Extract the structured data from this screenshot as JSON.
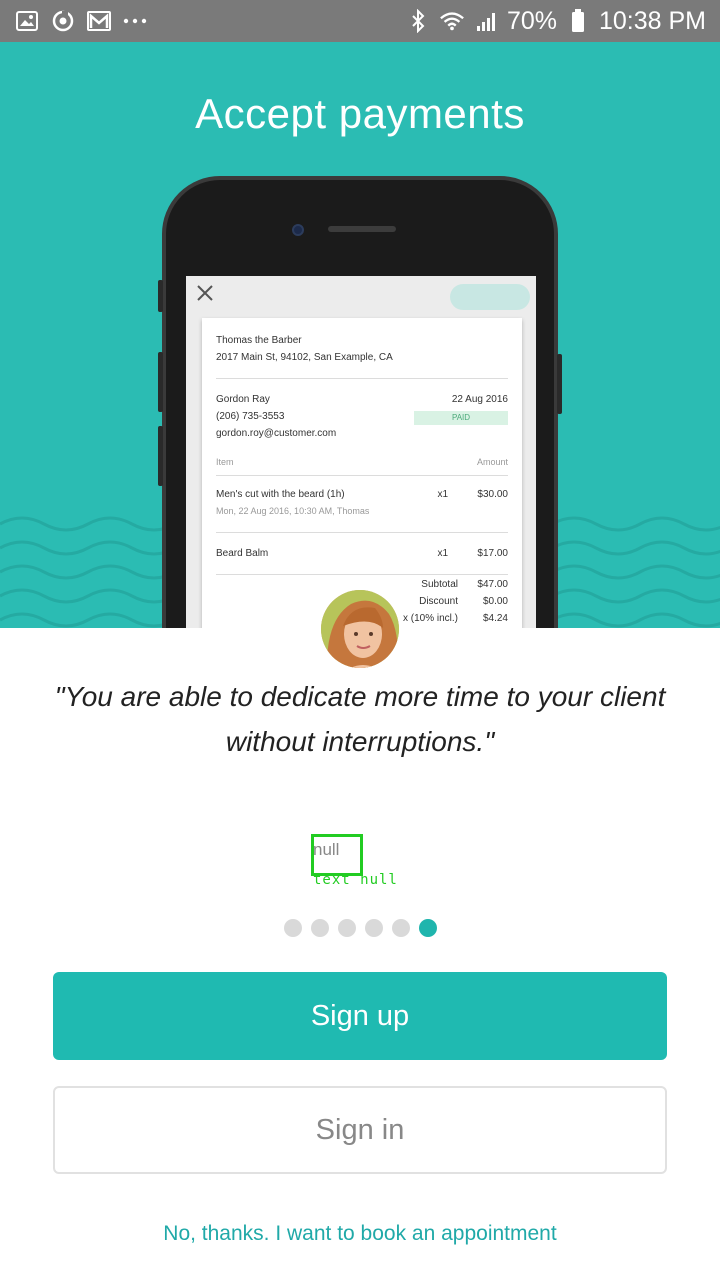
{
  "status_bar": {
    "battery": "70%",
    "time": "10:38 PM",
    "left_icons": [
      "image-icon",
      "sync-icon",
      "gmail-icon",
      "more-icon"
    ],
    "right_icons": [
      "bluetooth-icon",
      "wifi-icon",
      "signal-icon",
      "battery-icon"
    ]
  },
  "hero": {
    "title": "Accept payments",
    "background_color": "#2bbcb3"
  },
  "receipt": {
    "business_name": "Thomas the Barber",
    "business_address": "2017 Main St, 94102, San Example, CA",
    "customer_name": "Gordon Ray",
    "customer_phone": "(206) 735-3553",
    "customer_email": "gordon.roy@customer.com",
    "date": "22 Aug 2016",
    "status": "PAID",
    "col_item": "Item",
    "col_amount": "Amount",
    "items": [
      {
        "name": "Men's cut with the beard (1h)",
        "detail": "Mon, 22 Aug 2016, 10:30 AM, Thomas",
        "qty": "x1",
        "amount": "$30.00"
      },
      {
        "name": "Beard Balm",
        "detail": "",
        "qty": "x1",
        "amount": "$17.00"
      }
    ],
    "totals": [
      {
        "label": "Subtotal",
        "value": "$47.00"
      },
      {
        "label": "Discount",
        "value": "$0.00"
      },
      {
        "label": "x (10% incl.)",
        "value": "$4.24"
      }
    ]
  },
  "testimonial": {
    "quote": "\"You are able to dedicate more time to your client without interruptions.\"",
    "author": "null",
    "debug_label": "text null"
  },
  "pagination": {
    "total": 6,
    "active_index": 5
  },
  "buttons": {
    "sign_up": "Sign up",
    "sign_in": "Sign in",
    "book_link": "No, thanks. I want to book an appointment"
  },
  "colors": {
    "accent": "#1fbab1",
    "link": "#20a9a8",
    "status_bar": "#7a7a7a"
  }
}
